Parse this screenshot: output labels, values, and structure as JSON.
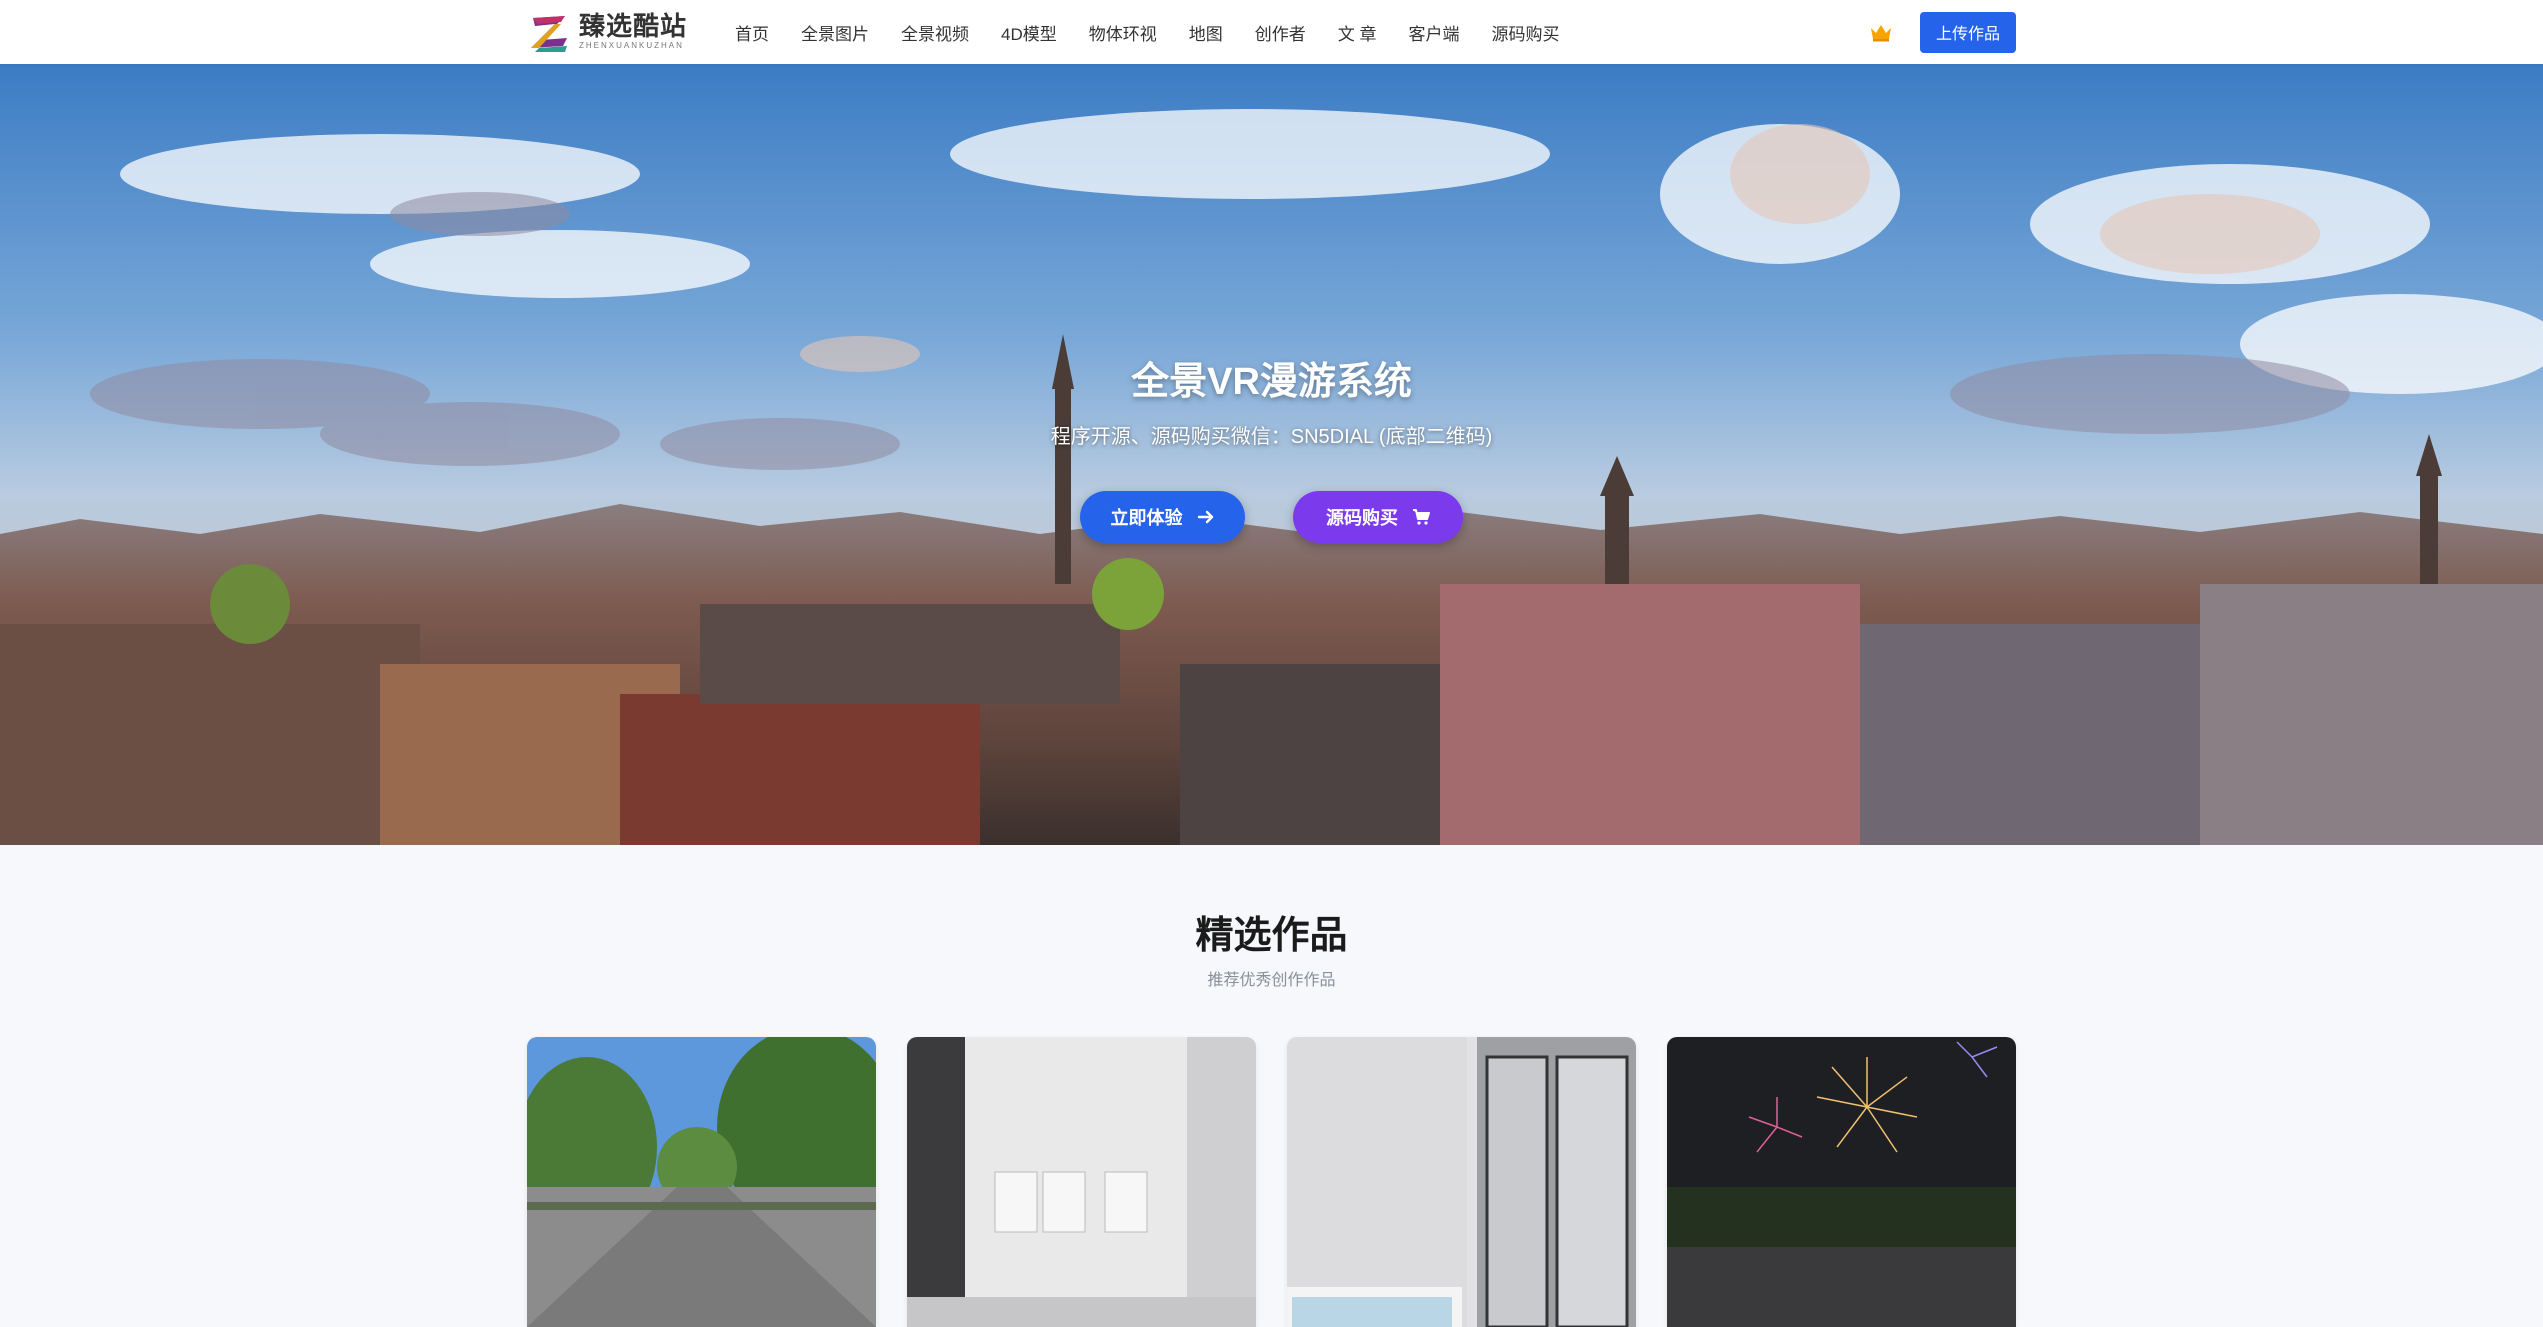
{
  "brand": {
    "name_cn": "臻选酷站",
    "name_en": "ZHENXUANKUZHAN"
  },
  "nav": {
    "items": [
      {
        "label": "首页"
      },
      {
        "label": "全景图片"
      },
      {
        "label": "全景视频"
      },
      {
        "label": "4D模型"
      },
      {
        "label": "物体环视"
      },
      {
        "label": "地图"
      },
      {
        "label": "创作者"
      },
      {
        "label": "文 章"
      },
      {
        "label": "客户端"
      },
      {
        "label": "源码购买"
      }
    ],
    "vip_icon": "crown-icon",
    "upload_label": "上传作品"
  },
  "hero": {
    "title": "全景VR漫游系统",
    "subtitle": "程序开源、源码购买微信：SN5DIAL (底部二维码)",
    "try_button": {
      "label": "立即体验",
      "icon": "arrow-right-icon"
    },
    "buy_button": {
      "label": "源码购买",
      "icon": "cart-icon"
    }
  },
  "featured": {
    "title": "精选作品",
    "subtitle": "推荐优秀创作作品",
    "cards": [
      {
        "name": "street-panorama"
      },
      {
        "name": "gallery-panorama"
      },
      {
        "name": "bathroom-panorama"
      },
      {
        "name": "fireworks-panorama"
      }
    ]
  },
  "colors": {
    "primary": "#2563eb",
    "purple": "#7c3aed",
    "crown": "#f5a400"
  }
}
